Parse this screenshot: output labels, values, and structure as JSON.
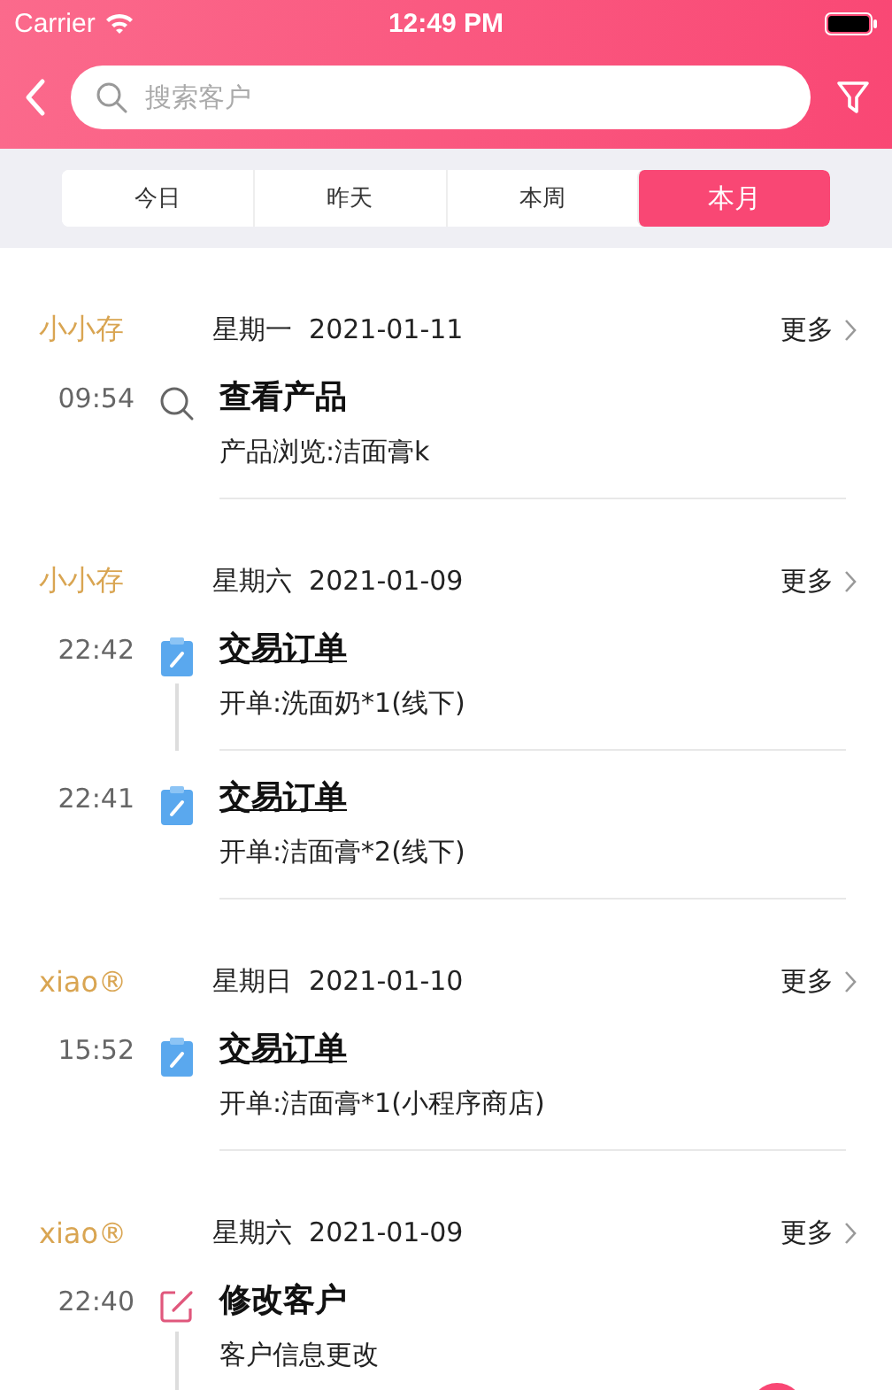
{
  "status_bar": {
    "carrier": "Carrier",
    "time": "12:49 PM"
  },
  "search": {
    "placeholder": "搜索客户"
  },
  "tabs": [
    {
      "label": "今日",
      "selected": false
    },
    {
      "label": "昨天",
      "selected": false
    },
    {
      "label": "本周",
      "selected": false
    },
    {
      "label": "本月",
      "selected": true
    }
  ],
  "groups": [
    {
      "customer": "小小存",
      "date": "星期一  2021-01-11",
      "more": "更多",
      "entries": [
        {
          "kind": "view",
          "time": "09:54",
          "title": "查看产品",
          "detail": "产品浏览:洁面膏k",
          "line_below": false
        }
      ]
    },
    {
      "customer": "小小存",
      "date": "星期六  2021-01-09",
      "more": "更多",
      "entries": [
        {
          "kind": "order",
          "time": "22:42",
          "title": "交易订单",
          "detail": "开单:洗面奶*1(线下)",
          "line_below": true
        },
        {
          "kind": "order",
          "time": "22:41",
          "title": "交易订单",
          "detail": "开单:洁面膏*2(线下)",
          "line_below": false
        }
      ]
    },
    {
      "customer": "xiao®",
      "date": "星期日  2021-01-10",
      "more": "更多",
      "entries": [
        {
          "kind": "order",
          "time": "15:52",
          "title": "交易订单",
          "detail": "开单:洁面膏*1(小程序商店)",
          "line_below": false
        }
      ]
    },
    {
      "customer": "xiao®",
      "date": "星期六  2021-01-09",
      "more": "更多",
      "entries": [
        {
          "kind": "edit",
          "time": "22:40",
          "title": "修改客户",
          "detail": "客户信息更改",
          "line_below": true
        }
      ]
    }
  ]
}
